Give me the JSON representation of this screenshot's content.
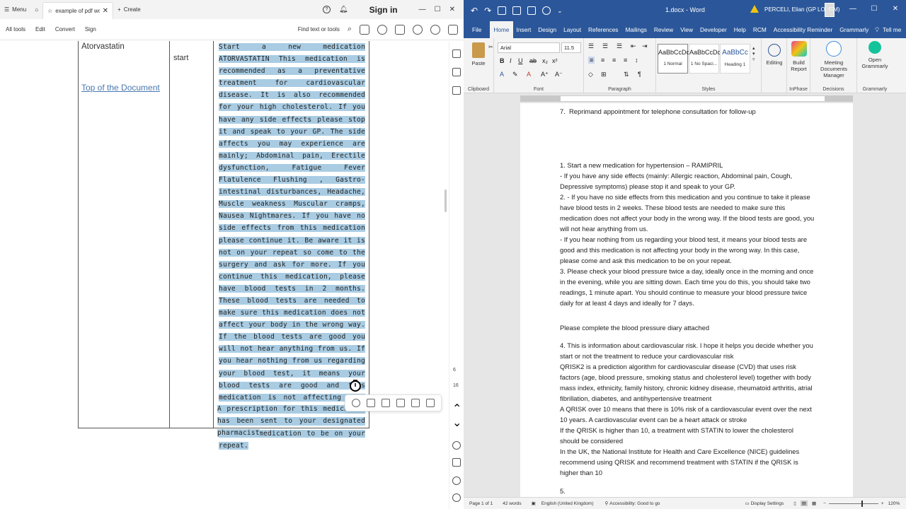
{
  "pdf": {
    "tabbar": {
      "menu_label": "Menu",
      "tab_title": "example of pdf working ...",
      "create_label": "Create",
      "signin_label": "Sign in"
    },
    "toolbar": {
      "items": [
        "All tools",
        "Edit",
        "Convert",
        "Sign"
      ],
      "find_label": "Find text or tools"
    },
    "table": {
      "drug_name": "Atorvastatin",
      "top_link": "Top of the Document",
      "action": "start",
      "paragraph_1": "Start a new medication ATORVASTATIN This medication is recommended as a preventative treatment for cardiovascular disease. It is also recommended for your high cholesterol.  If you have any side effects please stop it and speak to your GP. The side affects you may experience are mainly; Abdominal pain, Erectile dysfunction, Fatigue Fever Flatulence Flushing , Gastro-intestinal disturbances, Headache, Muscle weakness Muscular cramps, Nausea Nightmares. If you have no side effects from this medication please continue it. Be aware it is not on your repeat so come to the surgery and ask for more. If you continue this medication, please have blood tests in 2 months. These blood tests are needed to make sure this medication does not affect your body in the wrong way. If the blood tests are good you will not hear anything from us. If you hear nothing from us regarding your blood test, it means your blood tests are good and this medication is not affecting your body in the wrong way. In this case, please phone the surgery and ask this medication to be on your repeat.",
      "paragraph_2": "A prescription for this medication has been sent to your designated pharmacist"
    },
    "sidebar_numbers": [
      "6",
      "16"
    ]
  },
  "word": {
    "doc_title": "1.docx  -  Word",
    "user_name": "PERCELI, Elian (GP LOCUM)",
    "tabs": [
      "File",
      "Home",
      "Insert",
      "Design",
      "Layout",
      "References",
      "Mailings",
      "Review",
      "View",
      "Developer",
      "Help",
      "RCM",
      "Accessibility Reminder",
      "Grammarly",
      "Tell me"
    ],
    "active_tab": "Home",
    "ribbon": {
      "font_name": "Arial",
      "font_size": "11.5",
      "paste_label": "Paste",
      "groups": {
        "clipboard": "Clipboard",
        "font": "Font",
        "paragraph": "Paragraph",
        "styles": "Styles",
        "inphase": "InPhase",
        "decisions": "Decisions",
        "grammarly": "Grammarly"
      },
      "styles": [
        {
          "sample": "AaBbCcDc",
          "name": "1 Normal"
        },
        {
          "sample": "AaBbCcDc",
          "name": "1 No Spaci..."
        },
        {
          "sample": "AaBbCc",
          "name": "Heading 1"
        }
      ],
      "editing_label": "Editing",
      "build_report_label": "Build Report",
      "meeting_docs_label": "Meeting Documents Manager",
      "open_grammarly_label": "Open Grammarly"
    },
    "document": {
      "line_top": "7.  Reprimand appointment for telephone consultation for follow-up",
      "block_1": "1. Start a new medication for hypertension – RAMIPRIL\n- If you have any side effects (mainly: Allergic reaction, Abdominal pain, Cough, Depressive symptoms) please stop it and speak to your GP.\n2. - If you have no side effects from this medication and you continue to take it please have blood tests in 2 weeks. These blood tests are needed to make sure this medication does not affect your body in the wrong way. If the blood tests are good, you will not hear anything from us.\n- If you hear nothing from us regarding your blood test, it means your blood tests are good and this medication is not affecting your body in the wrong way. In this case, please come and ask this medication to be on your repeat.\n3. Please check your blood pressure twice a day, ideally once in the morning and once in the evening, while you are sitting down. Each time you do this, you should take two readings, 1 minute apart. You should continue to measure your blood pressure twice daily for at least 4 days and ideally for 7 days.",
      "block_2": "Please complete the blood pressure diary attached",
      "block_3": "4. This is information about cardiovascular risk. I hope it helps you decide whether you start or not the treatment to reduce your cardiovascular risk\nQRISK2 is a prediction algorithm for cardiovascular disease (CVD) that uses risk factors (age, blood pressure, smoking status and cholesterol level) together with body mass index, ethnicity, family history, chronic kidney disease, rheumatoid arthritis, atrial fibrillation, diabetes, and antihypertensive treatment\nA QRISK over 10 means that there is 10% risk of a cardiovascular event over the next 10 years. A cardiovascular event can be a heart attack or stroke\nIf the QRISK is higher than 10, a treatment with STATIN to lower the cholesterol should be considered\nIn the UK, the National Institute for Health and Care Excellence (NICE) guidelines recommend using QRISK and recommend treatment with STATIN if the QRISK is higher than 10",
      "block_4": "5."
    },
    "statusbar": {
      "page": "Page 1 of 1",
      "words": "42 words",
      "language": "English (United Kingdom)",
      "accessibility": "Accessibility: Good to go",
      "display_settings": "Display Settings",
      "zoom": "120%"
    },
    "colors": {
      "title_bar": "#2b579a",
      "highlight": "#a9cce3"
    }
  }
}
